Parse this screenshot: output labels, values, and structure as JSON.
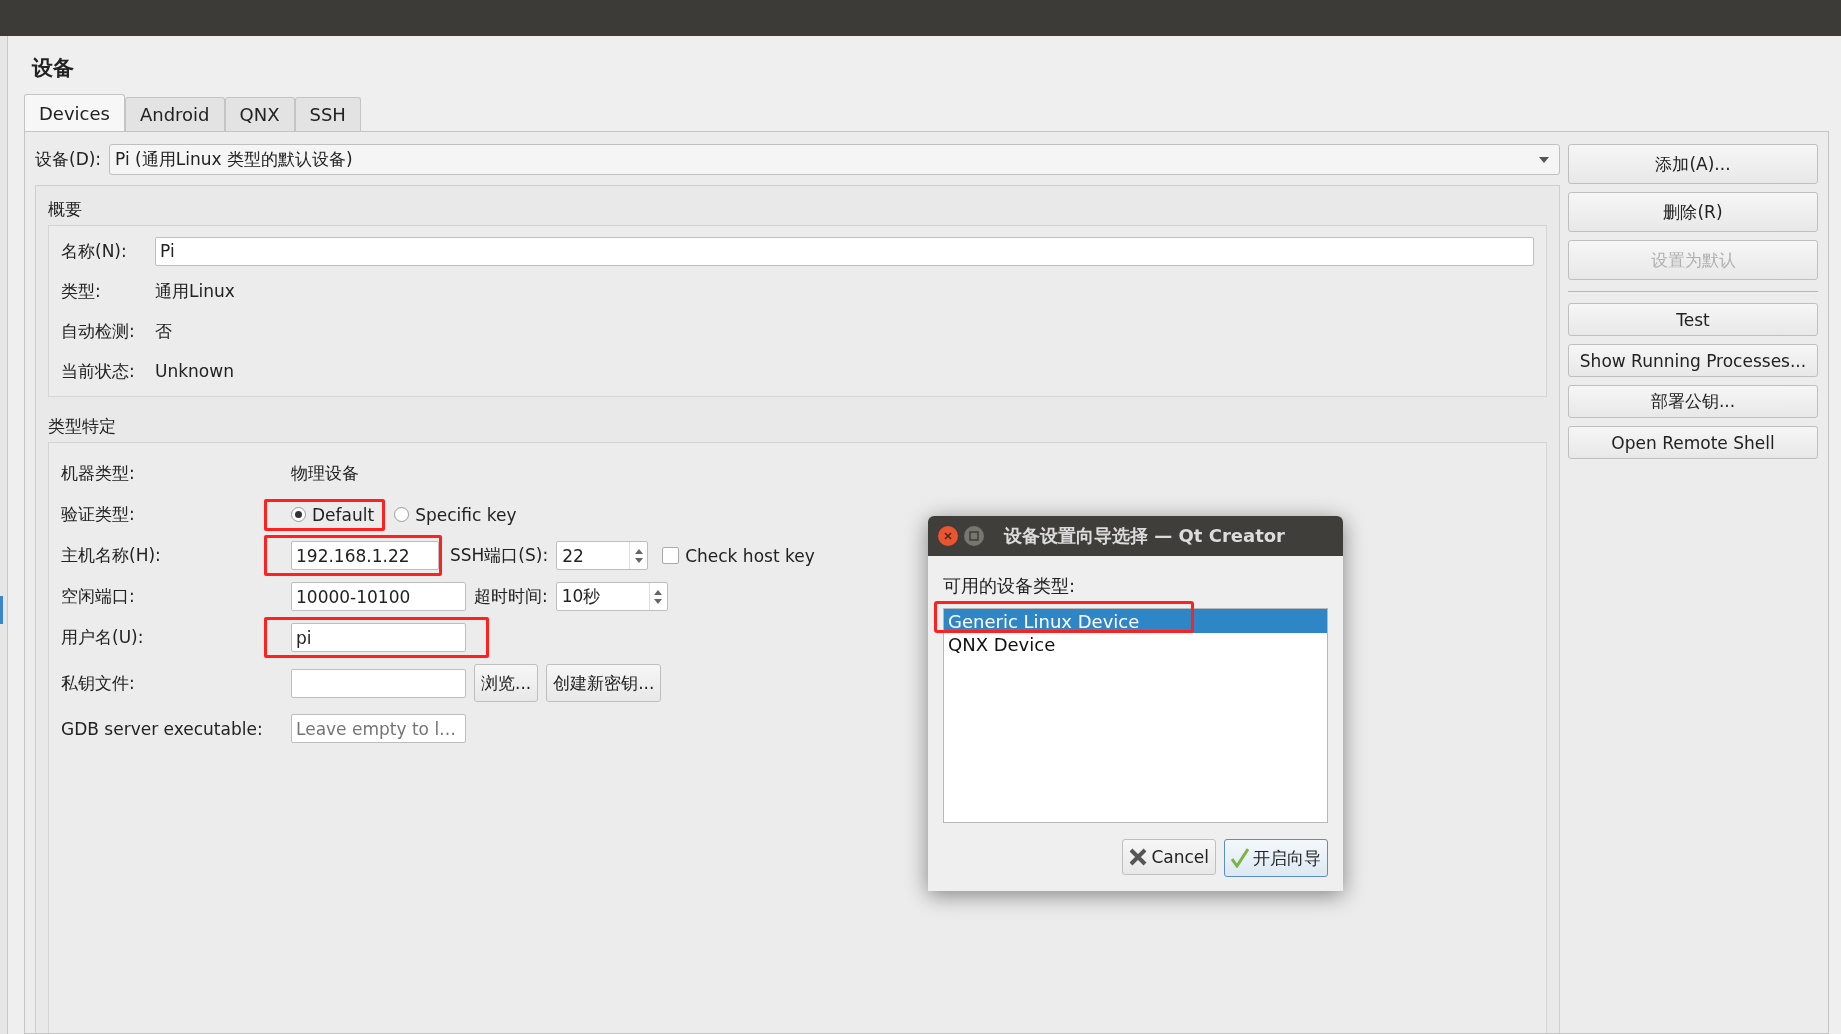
{
  "window": {
    "title": "设备"
  },
  "tabs": [
    {
      "label": "Devices",
      "selected": true
    },
    {
      "label": "Android",
      "selected": false
    },
    {
      "label": "QNX",
      "selected": false
    },
    {
      "label": "SSH",
      "selected": false
    }
  ],
  "device_selector": {
    "label": "设备(D):",
    "value": "Pi (通用Linux 类型的默认设备)"
  },
  "summary": {
    "title": "概要",
    "name_label": "名称(N):",
    "name_value": "Pi",
    "rows": [
      {
        "label": "类型:",
        "value": "通用Linux"
      },
      {
        "label": "自动检测:",
        "value": "否"
      },
      {
        "label": "当前状态:",
        "value": "Unknown"
      }
    ]
  },
  "type_specific": {
    "title": "类型特定",
    "machine_type": {
      "label": "机器类型:",
      "value": "物理设备"
    },
    "auth": {
      "label": "验证类型:",
      "options": [
        {
          "label": "Default",
          "selected": true,
          "highlighted": true
        },
        {
          "label": "Specific key",
          "selected": false,
          "highlighted": false
        }
      ]
    },
    "host": {
      "label": "主机名称(H):",
      "value": "192.168.1.22",
      "highlighted": true,
      "port_label": "SSH端口(S):",
      "port_value": "22",
      "check_host_key": {
        "label": "Check host key",
        "checked": false
      }
    },
    "free_ports": {
      "label": "空闲端口:",
      "value": "10000-10100",
      "timeout_label": "超时时间:",
      "timeout_value": "10秒"
    },
    "username": {
      "label": "用户名(U):",
      "value": "pi",
      "highlighted": true
    },
    "key_file": {
      "label": "私钥文件:",
      "buttons": [
        "浏览...",
        "创建新密钥..."
      ]
    },
    "gdb": {
      "label": "GDB server executable:",
      "placeholder": "Leave empty to l…"
    }
  },
  "buttons": [
    {
      "label": "添加(A)...",
      "disabled": false
    },
    {
      "label": "删除(R)",
      "disabled": false
    },
    {
      "label": "设置为默认",
      "disabled": true
    }
  ],
  "action_buttons": [
    {
      "label": "Test",
      "disabled": false
    },
    {
      "label": "Show Running Processes...",
      "disabled": false
    },
    {
      "label": "部署公钥...",
      "disabled": false
    },
    {
      "label": "Open Remote Shell",
      "disabled": false
    }
  ],
  "dialog": {
    "title": "设备设置向导选择 — Qt Creator",
    "list_label": "可用的设备类型:",
    "items": [
      {
        "label": "Generic Linux Device",
        "selected": true,
        "highlighted": true
      },
      {
        "label": "QNX Device",
        "selected": false,
        "highlighted": false
      }
    ],
    "cancel": "Cancel",
    "confirm": "开启向导"
  }
}
